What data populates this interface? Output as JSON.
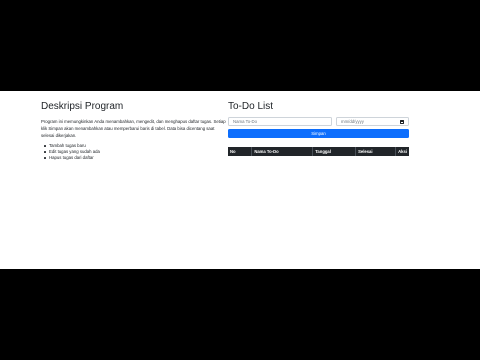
{
  "left": {
    "title": "Deskripsi Program",
    "description": "Program ini memungkinkan Anda menambahkan, mengedit, dan menghapus daftar tugas. Setiap klik Simpan akan menambahkan atau memperbarui baris di tabel. Data bisa dicentang saat selesai dikerjakan.",
    "features": [
      "Tambah tugas baru",
      "Edit tugas yang sudah ada",
      "Hapus tugas dari daftar"
    ]
  },
  "right": {
    "title": "To-Do List",
    "name_placeholder": "Nama To-Do",
    "date_placeholder": "mm/dd/yyyy",
    "save_label": "Simpan",
    "table_headers": [
      "No",
      "Nama To-Do",
      "Tanggal",
      "Selesai",
      "Aksi"
    ]
  }
}
